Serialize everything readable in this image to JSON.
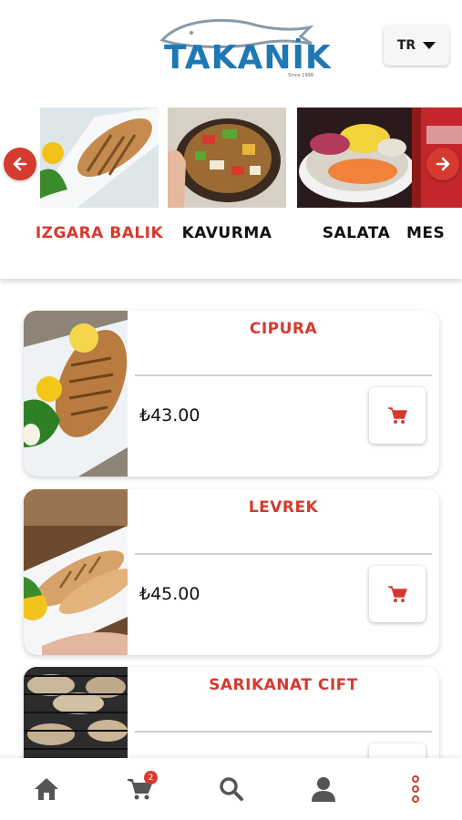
{
  "header": {
    "brand": "TAKANİK",
    "brand_since": "Since 1998",
    "language": "TR"
  },
  "categories": [
    {
      "label": "IZGARA BALIK",
      "active": true
    },
    {
      "label": "KAVURMA",
      "active": false
    },
    {
      "label": "SALATA",
      "active": false
    },
    {
      "label": "MES",
      "active": false
    }
  ],
  "products": [
    {
      "name": "CIPURA",
      "price": "₺43.00"
    },
    {
      "name": "LEVREK",
      "price": "₺45.00"
    },
    {
      "name": "SARIKANAT CIFT",
      "price": ""
    }
  ],
  "cart": {
    "count": "2"
  },
  "colors": {
    "accent": "#d63a2f",
    "brand_blue": "#1f78b4"
  },
  "nav": [
    "home-icon",
    "cart-icon",
    "search-icon",
    "user-icon",
    "more-icon"
  ]
}
